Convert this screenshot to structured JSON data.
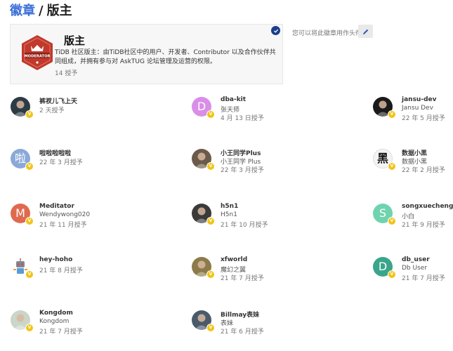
{
  "breadcrumb": {
    "link": "徽章",
    "separator": "/",
    "current": "版主"
  },
  "badge": {
    "icon_text": "MODERATOR",
    "name": "版主",
    "description": "TiDB 社区版主：由TiDB社区中的用户、开发者、Contributor 以及合作伙伴共同组成，并拥有参与对 AskTUG 论坛管理及运营的权限。",
    "granted_count": "14 授予",
    "color": "#c0392b"
  },
  "favorite": {
    "hint": "您可以将此徽章用作头衔",
    "checked": true
  },
  "edit_icon": "pencil-icon",
  "verified_badge_letter": "V",
  "users": [
    {
      "username": "裤衩儿飞上天",
      "name": "",
      "date": "2 天授予",
      "avatar_type": "photo",
      "color": "#2d3b45"
    },
    {
      "username": "dba-kit",
      "name": "张天师",
      "date": "4 月 13 日授予",
      "avatar_type": "letter",
      "letter": "D",
      "color": "#d98ee8"
    },
    {
      "username": "jansu-dev",
      "name": "Jansu Dev",
      "date": "22 年 5 月授予",
      "avatar_type": "photo",
      "color": "#1a1a1a"
    },
    {
      "username": "啦啦啦啦啦",
      "name": "",
      "date": "22 年 3 月授予",
      "avatar_type": "letter",
      "letter": "啦",
      "color": "#8aa8d8"
    },
    {
      "username": "小王同学Plus",
      "name": "小王同学 Plus",
      "date": "22 年 3 月授予",
      "avatar_type": "photo",
      "color": "#6b5a4a"
    },
    {
      "username": "数据小黑",
      "name": "数据小黑",
      "date": "22 年 2 月授予",
      "avatar_type": "text",
      "letter": "黑",
      "color": "#f4f4f4"
    },
    {
      "username": "Meditator",
      "name": "Wendywong020",
      "date": "21 年 11 月授予",
      "avatar_type": "letter",
      "letter": "M",
      "color": "#e06a50"
    },
    {
      "username": "h5n1",
      "name": "H5n1",
      "date": "21 年 10 月授予",
      "avatar_type": "photo",
      "color": "#3a3a3a"
    },
    {
      "username": "songxuecheng",
      "name": "小白",
      "date": "21 年 9 月授予",
      "avatar_type": "letter",
      "letter": "S",
      "color": "#6fd3b0"
    },
    {
      "username": "hey-hoho",
      "name": "",
      "date": "21 年 8 月授予",
      "avatar_type": "robot",
      "color": "#ffffff"
    },
    {
      "username": "xfworld",
      "name": "魔幻之翼",
      "date": "21 年 7 月授予",
      "avatar_type": "photo",
      "color": "#8b7b4a"
    },
    {
      "username": "db_user",
      "name": "Db User",
      "date": "21 年 7 月授予",
      "avatar_type": "letter",
      "letter": "D",
      "color": "#3aa58a"
    },
    {
      "username": "Kongdom",
      "name": "Kongdom",
      "date": "21 年 7 月授予",
      "avatar_type": "photo",
      "color": "#c9d6c9"
    },
    {
      "username": "Billmay表妹",
      "name": "表妹",
      "date": "21 年 6 月授予",
      "avatar_type": "photo",
      "color": "#4a5a6a"
    }
  ]
}
